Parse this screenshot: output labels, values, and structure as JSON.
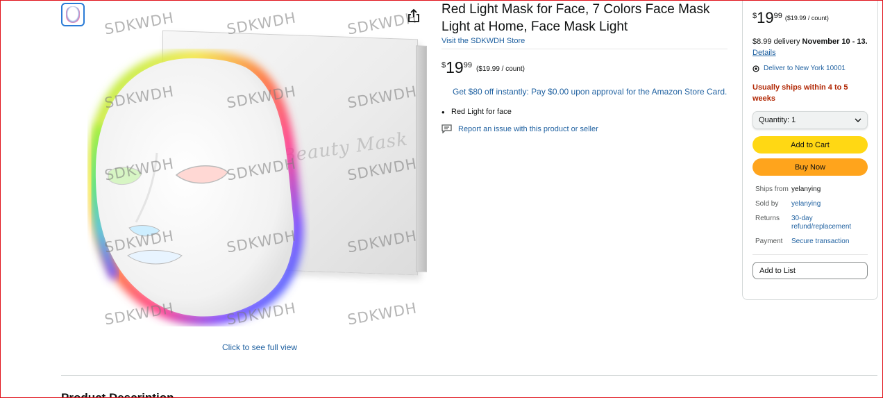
{
  "gallery": {
    "thumbnail_alt": "mask thumbnail",
    "watermark": "SDKWDH",
    "box_script": "Beauty Mask",
    "full_view_link": "Click to see full view"
  },
  "product": {
    "title": "Red Light Mask for Face, 7 Colors Face Mask Light at Home, Face Mask Light",
    "store_link": "Visit the SDKWDH Store",
    "price": {
      "symbol": "$",
      "whole": "19",
      "fraction": "99",
      "unit": "($19.99 / count)"
    },
    "promo": "Get $80 off instantly: Pay $0.00 upon approval for the Amazon Store Card.",
    "bullets": [
      "Red Light for face"
    ],
    "report_link": "Report an issue with this product or seller"
  },
  "buybox": {
    "price": {
      "symbol": "$",
      "whole": "19",
      "fraction": "99",
      "unit": "($19.99 / count)"
    },
    "delivery_prefix": "$8.99 delivery ",
    "delivery_dates": "November 10 - 13",
    "delivery_sep": ". ",
    "details_link": "Details",
    "deliver_to": "Deliver to New York 10001",
    "ships_note": "Usually ships within 4 to 5 weeks",
    "quantity_label": "Quantity: 1",
    "add_to_cart": "Add to Cart",
    "buy_now": "Buy Now",
    "info": [
      {
        "label": "Ships from",
        "value": "yelanying"
      },
      {
        "label": "Sold by",
        "value": "yelanying"
      },
      {
        "label": "Returns",
        "value": "30-day refund/replacement"
      },
      {
        "label": "Payment",
        "value": "Secure transaction"
      }
    ],
    "add_to_list": "Add to List"
  },
  "section": {
    "title": "Product Description"
  },
  "colors": {
    "link": "#2162a1",
    "cart": "#ffd814",
    "buy": "#ffa41c",
    "ships_note": "#b12704"
  },
  "icons": [
    "share-icon",
    "location-pin-icon",
    "chevron-down-icon",
    "report-chat-icon"
  ]
}
